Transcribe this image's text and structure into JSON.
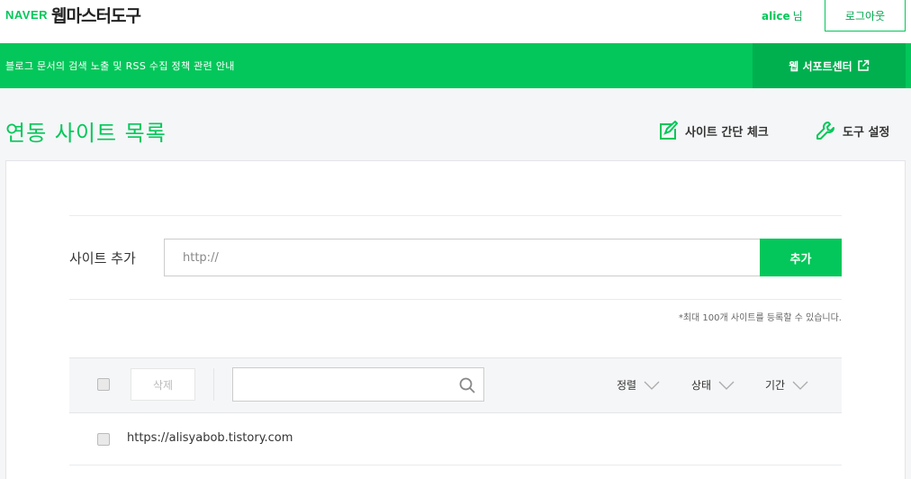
{
  "header": {
    "logo_naver": "NAVER",
    "logo_service": "웹마스터도구",
    "username": "alice",
    "username_suffix": "님",
    "logout_label": "로그아웃"
  },
  "banner": {
    "text": "블로그 문서의 검색 노출 및 RSS 수집 정책 관련 안내",
    "support_label": "웹 서포트센터",
    "support_icon": "external-link-icon"
  },
  "page": {
    "title": "연동 사이트 목록",
    "tool_check_label": "사이트 간단 체크",
    "tool_settings_label": "도구 설정"
  },
  "add_site": {
    "label": "사이트 추가",
    "placeholder": "http://",
    "button_label": "추가",
    "notice": "*최대 100개 사이트를 등록할 수 있습니다."
  },
  "toolbar": {
    "delete_label": "삭제",
    "search_placeholder": "",
    "filters": [
      {
        "label": "정렬"
      },
      {
        "label": "상태"
      },
      {
        "label": "기간"
      }
    ]
  },
  "sites": [
    {
      "url": "https://alisyabob.tistory.com",
      "checked": false
    }
  ],
  "colors": {
    "brand_green": "#03c75a",
    "banner_dark": "#00b04f"
  }
}
